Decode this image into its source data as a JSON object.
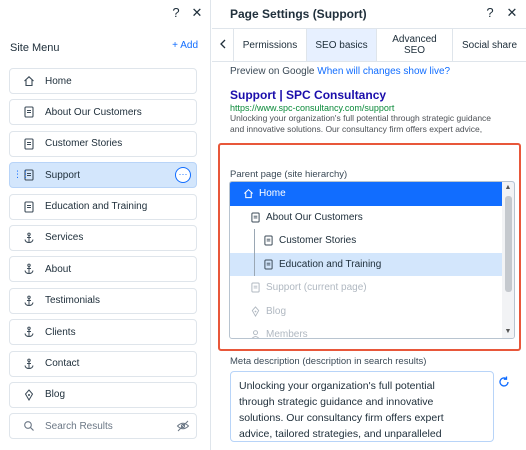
{
  "site_menu": {
    "help_label": "?",
    "close_label": "✕",
    "title": "Site Menu",
    "add_label": "+ Add",
    "items": [
      {
        "label": "Home",
        "icon": "home-icon"
      },
      {
        "label": "About Our Customers",
        "icon": "page-icon"
      },
      {
        "label": "Customer Stories",
        "icon": "page-icon"
      },
      {
        "label": "Support",
        "icon": "page-icon",
        "selected": true
      },
      {
        "label": "Education and Training",
        "icon": "page-icon"
      },
      {
        "label": "Services",
        "icon": "anchor-icon"
      },
      {
        "label": "About",
        "icon": "anchor-icon"
      },
      {
        "label": "Testimonials",
        "icon": "anchor-icon"
      },
      {
        "label": "Clients",
        "icon": "anchor-icon"
      },
      {
        "label": "Contact",
        "icon": "anchor-icon"
      },
      {
        "label": "Blog",
        "icon": "blog-icon"
      },
      {
        "label": "Search Results",
        "icon": "search-icon",
        "hidden": true
      }
    ],
    "more_label": "···"
  },
  "page_settings": {
    "title": "Page Settings (Support)",
    "help_label": "?",
    "close_label": "✕",
    "tabs": [
      {
        "label": "Permissions"
      },
      {
        "label": "SEO basics",
        "active": true
      },
      {
        "label": "Advanced SEO"
      },
      {
        "label": "Social share"
      }
    ],
    "preview": {
      "label": "Preview on Google",
      "link": "When will changes show live?",
      "title": "Support | SPC Consultancy",
      "url": "https://www.spc-consultancy.com/support",
      "desc1": "Unlocking your organization's full potential through strategic guidance",
      "desc2": "and innovative solutions. Our consultancy firm offers expert advice,"
    },
    "parent": {
      "label": "Parent page (site hierarchy)",
      "options": [
        {
          "label": "Home",
          "state": "selected"
        },
        {
          "label": "About Our Customers",
          "state": "normal"
        },
        {
          "label": "Customer Stories",
          "state": "normal"
        },
        {
          "label": "Education and Training",
          "state": "hover"
        },
        {
          "label": "Support (current page)",
          "state": "disabled"
        },
        {
          "label": "Blog",
          "state": "disabled"
        },
        {
          "label": "Members",
          "state": "disabled"
        }
      ]
    },
    "meta": {
      "label": "Meta description (description in search results)",
      "line1": "Unlocking your organization's full potential",
      "line2": "through strategic guidance and innovative",
      "line3": "solutions. Our consultancy firm offers expert",
      "line4": "advice, tailored strategies, and unparalleled"
    }
  },
  "colors": {
    "accent": "#116dff",
    "selected_bg": "#d3e6fc",
    "highlight": "#e8573a"
  }
}
